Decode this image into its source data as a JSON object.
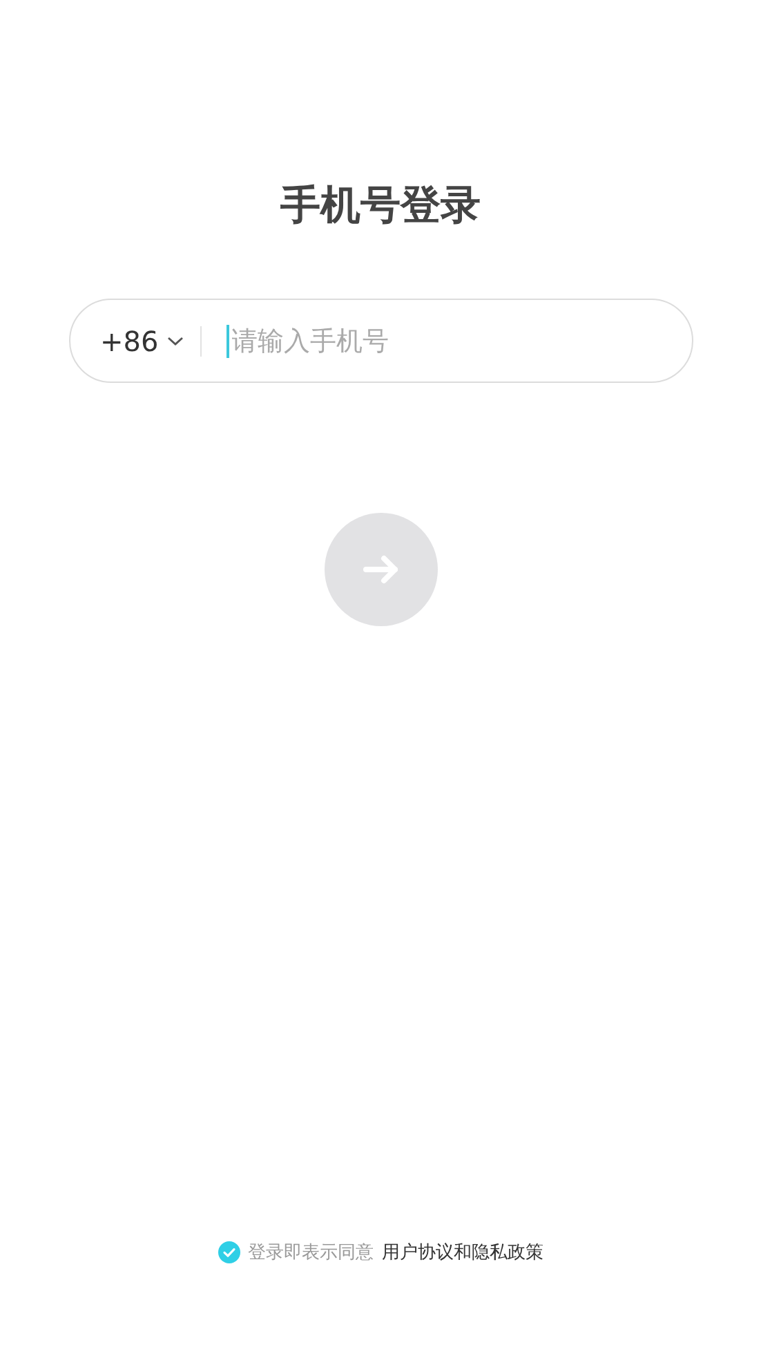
{
  "title": "手机号登录",
  "phone_field": {
    "country_code": "+86",
    "placeholder": "请输入手机号"
  },
  "next_button": {
    "disabled": true
  },
  "agreement": {
    "checked": true,
    "text": "登录即表示同意",
    "link": "用户协议和隐私政策"
  }
}
